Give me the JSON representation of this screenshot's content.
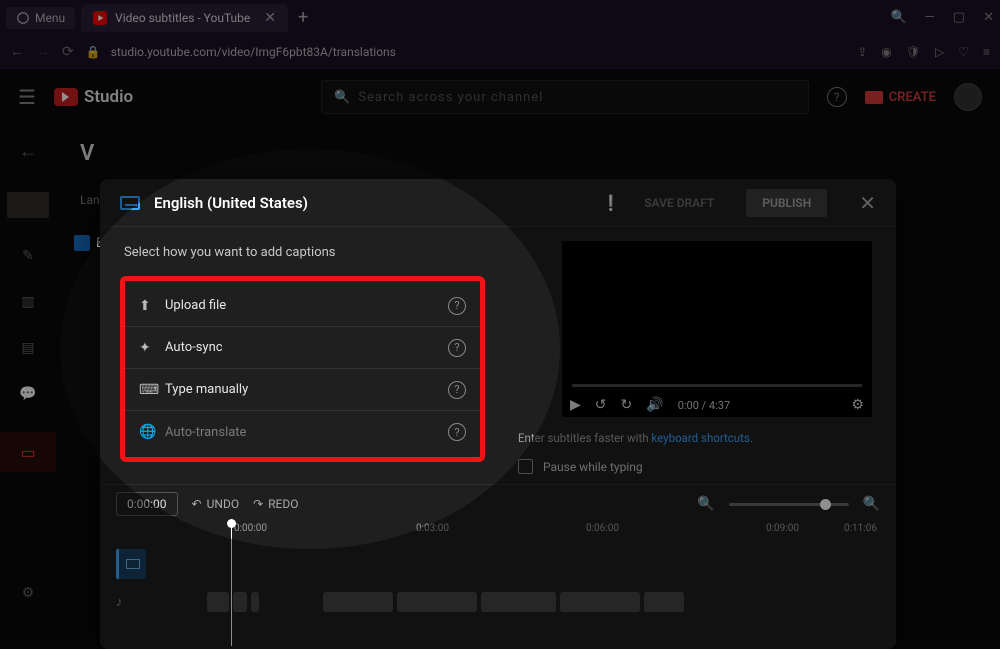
{
  "browser": {
    "menu_label": "Menu",
    "tab_title": "Video subtitles - YouTube",
    "url": "studio.youtube.com/video/ImgF6pbt83A/translations"
  },
  "studio_header": {
    "brand": "Studio",
    "search_placeholder": "Search across your channel",
    "create_label": "CREATE"
  },
  "page": {
    "title_letter": "V",
    "language_header": "Lan",
    "eng_label": "Eng"
  },
  "panel": {
    "language_title": "English (United States)",
    "save_draft": "SAVE DRAFT",
    "publish": "PUBLISH",
    "select_prompt": "Select how you want to add captions",
    "options": {
      "upload": "Upload file",
      "autosync": "Auto-sync",
      "manual": "Type manually",
      "autotranslate": "Auto-translate"
    },
    "hint_prefix": "Enter subtitles faster with ",
    "hint_link": "keyboard shortcuts",
    "pause_label": "Pause while typing"
  },
  "player": {
    "current": "0:00",
    "total": "4:37"
  },
  "timeline": {
    "time_box": "0:00:00",
    "undo": "UNDO",
    "redo": "REDO",
    "marks": {
      "m0": "0:00:00",
      "m3": "0:03:00",
      "m6": "0:06:00",
      "m9": "0:09:00",
      "m11": "0:11:06"
    }
  }
}
